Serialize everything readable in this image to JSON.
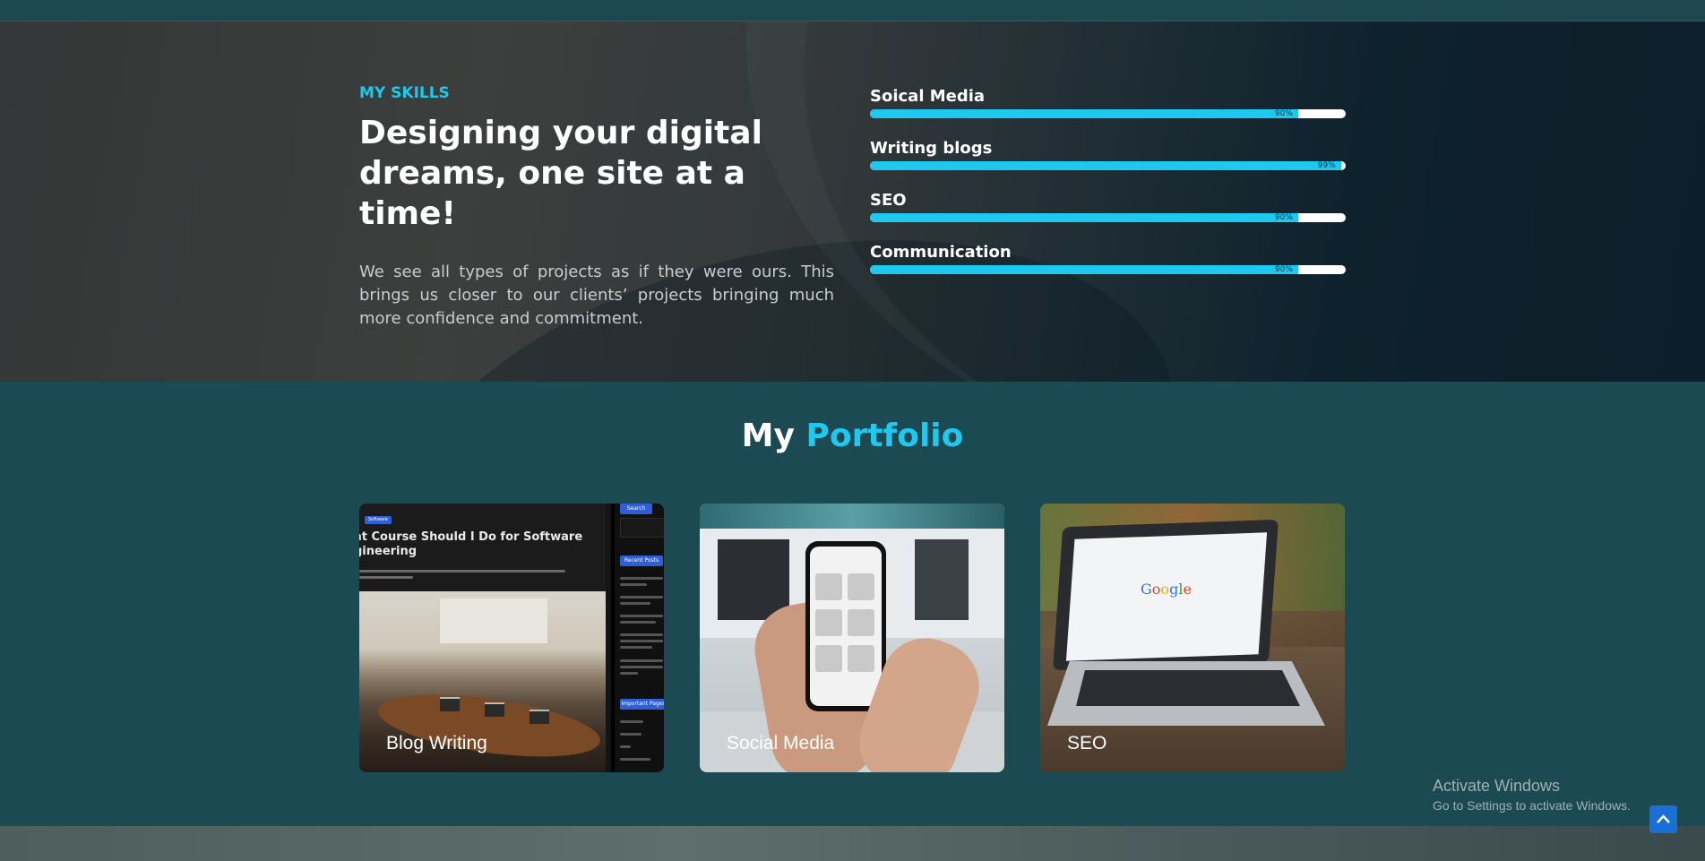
{
  "skills_section": {
    "eyebrow": "MY SKILLS",
    "headline": "Designing your digital dreams, one site at a time!",
    "paragraph": "We see all types of projects as if they were ours. This brings us closer to our clients’ projects bringing much more confidence and commitment.",
    "bars": [
      {
        "label": "Soical Media",
        "percent": 90,
        "percent_text": "90%"
      },
      {
        "label": "Writing blogs",
        "percent": 99,
        "percent_text": "99%"
      },
      {
        "label": "SEO",
        "percent": 90,
        "percent_text": "90%"
      },
      {
        "label": "Communication",
        "percent": 90,
        "percent_text": "90%"
      }
    ]
  },
  "portfolio": {
    "title_plain": "My",
    "title_accent": "Portfolio",
    "cards": [
      {
        "label": "Blog Writing"
      },
      {
        "label": "Social Media"
      },
      {
        "label": "SEO"
      }
    ],
    "blog_screenshot": {
      "category_chip": "Software",
      "post_title": "at Course Should I Do for Software gineering",
      "sidebar_search_btn": "Search",
      "sidebar_recent_btn": "Recent Posts",
      "sidebar_pages_btn": "Important Pages"
    },
    "seo_screenshot": {
      "logo_text": "Google"
    }
  },
  "os_watermark": {
    "line1": "Activate Windows",
    "line2": "Go to Settings to activate Windows."
  },
  "colors": {
    "accent": "#1fc8ef",
    "section_bg": "#1c4a52",
    "scroll_button": "#1a6fd6"
  }
}
